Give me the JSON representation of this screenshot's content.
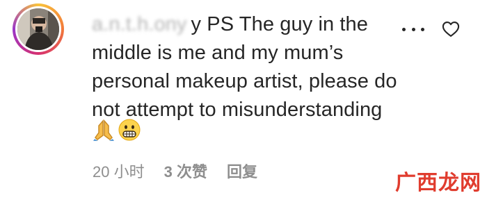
{
  "comment": {
    "username": "a.n.t.h.ony",
    "text_lines": [
      "y PS The guy in the",
      "middle is me and my mum’s",
      "personal makeup artist, please do",
      "not attempt to misunderstanding"
    ],
    "emojis": [
      "folded-hands-emoji",
      "grimacing-face-emoji"
    ]
  },
  "meta": {
    "time": "20 小时",
    "likes": "3 次赞",
    "reply": "回复"
  },
  "icons": {
    "more": "more-icon",
    "like": "heart-icon"
  },
  "watermark": "广西龙网",
  "colors": {
    "text": "#262626",
    "secondary_text": "#8e8e8e",
    "watermark": "#e03c2e"
  }
}
